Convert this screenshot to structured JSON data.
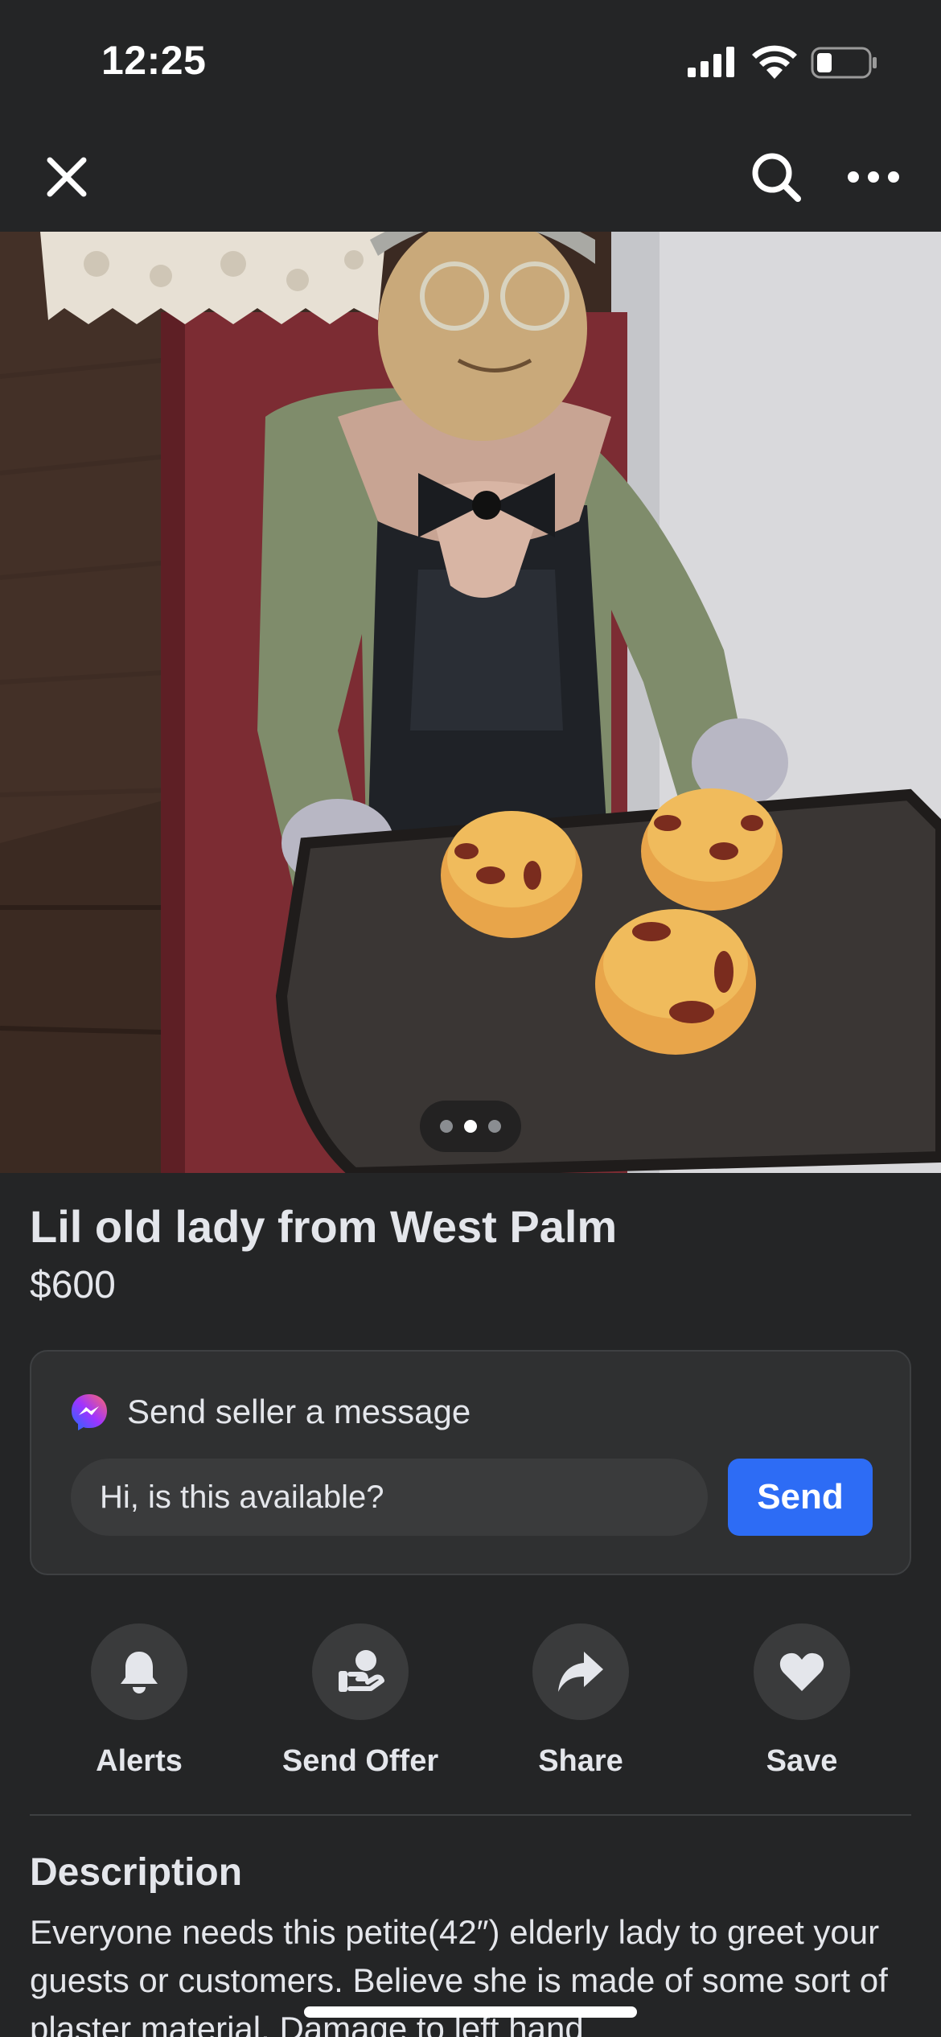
{
  "status_bar": {
    "time": "12:25",
    "icons": [
      "cellular-signal-icon",
      "wifi-icon",
      "battery-icon"
    ]
  },
  "nav": {
    "icons": [
      "close-icon",
      "search-icon",
      "more-icon"
    ]
  },
  "photo": {
    "pager_total": 3,
    "pager_active": 2
  },
  "listing": {
    "title": "Lil old lady from West Palm",
    "price": "$600"
  },
  "message": {
    "heading": "Send seller a message",
    "input_value": "Hi, is this available?",
    "send_label": "Send"
  },
  "actions": [
    {
      "label": "Alerts",
      "icon": "bell-icon"
    },
    {
      "label": "Send Offer",
      "icon": "offer-hand-icon"
    },
    {
      "label": "Share",
      "icon": "share-arrow-icon"
    },
    {
      "label": "Save",
      "icon": "heart-icon"
    }
  ],
  "description": {
    "heading": "Description",
    "body": "Everyone needs this petite(42″) elderly lady to greet your guests or customers.  Believe she is made of some sort of plaster material. Damage to left hand"
  },
  "colors": {
    "background": "#242526",
    "card": "#2f3031",
    "accent": "#2d6cf5",
    "text": "#e4e6eb"
  }
}
